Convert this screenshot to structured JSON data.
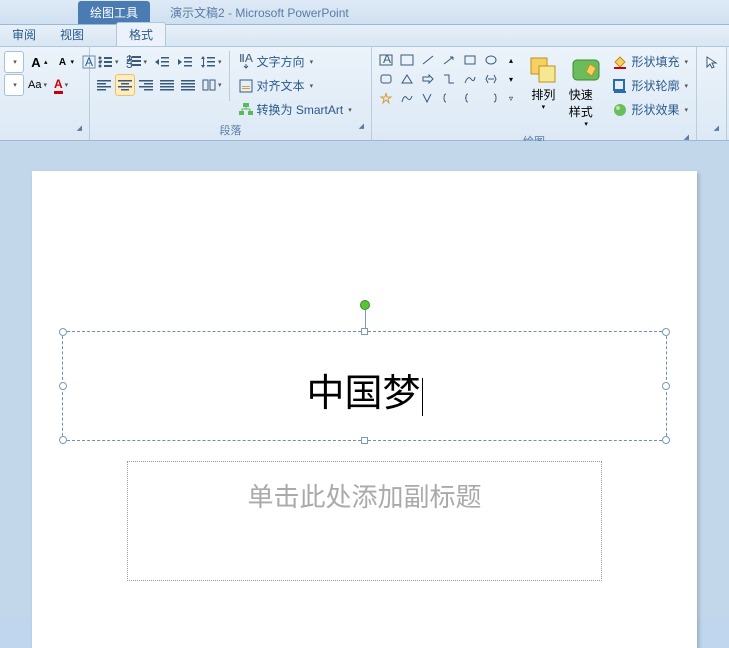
{
  "title": {
    "context_tab": "绘图工具",
    "doc": "演示文稿2 - Microsoft PowerPoint"
  },
  "tabs": {
    "t1": "审阅",
    "t2": "视图",
    "t3": "格式"
  },
  "font": {
    "grow": "A",
    "shrink": "A",
    "clear": "Aa",
    "color": "A"
  },
  "para": {
    "label": "段落",
    "text_dir": "文字方向",
    "align_text": "对齐文本",
    "smartart": "转换为 SmartArt"
  },
  "draw": {
    "label": "绘图",
    "arrange": "排列",
    "quickstyle": "快速样式",
    "fill": "形状填充",
    "outline": "形状轮廓",
    "effects": "形状效果"
  },
  "slide": {
    "title": "中国梦",
    "subtitle": "单击此处添加副标题"
  }
}
